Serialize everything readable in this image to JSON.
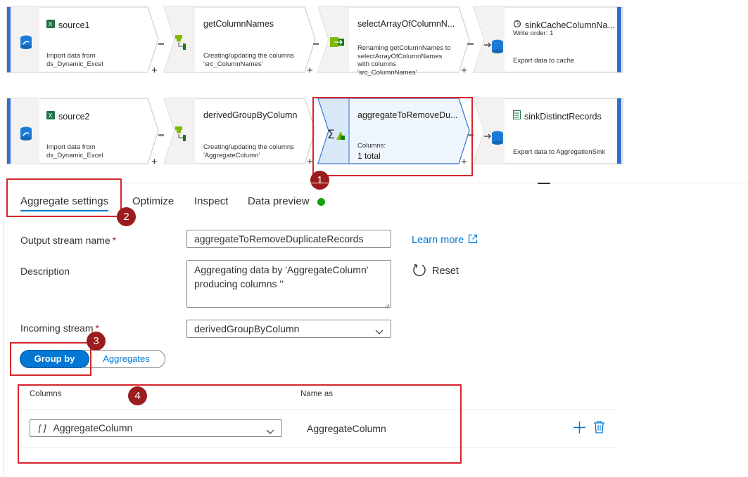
{
  "pipeline": {
    "row1": [
      {
        "title": "source1",
        "desc": "Import data from\nds_Dynamic_Excel"
      },
      {
        "title": "getColumnNames",
        "desc": "Creating/updating the columns\n'src_ColumnNames'"
      },
      {
        "title": "selectArrayOfColumnN...",
        "desc": "Renaming getColumnNames to\nselectArrayOfColumnNames\nwith columns\n'src_ColumnNames'"
      },
      {
        "title": "sinkCacheColumnNa...",
        "subtitle": "Write order: 1",
        "desc": "Export data to cache"
      }
    ],
    "row2": [
      {
        "title": "source2",
        "desc": "Import data from\nds_Dynamic_Excel"
      },
      {
        "title": "derivedGroupByColumn",
        "desc": "Creating/updating the columns\n'AggregateColumn'"
      },
      {
        "title": "aggregateToRemoveDu...",
        "columns_label": "Columns:",
        "columns_value": "1 total"
      },
      {
        "title": "sinkDistinctRecords",
        "desc": "Export data to AggregationSink"
      }
    ],
    "plus": "+"
  },
  "callouts": [
    "1",
    "2",
    "3",
    "4"
  ],
  "tabs": [
    {
      "label": "Aggregate settings",
      "active": true
    },
    {
      "label": "Optimize"
    },
    {
      "label": "Inspect"
    },
    {
      "label": "Data preview"
    }
  ],
  "form": {
    "output_stream_label": "Output stream name",
    "required_mark": "*",
    "output_stream_value": "aggregateToRemoveDuplicateRecords",
    "learn_more": "Learn more",
    "description_label": "Description",
    "description_value": "Aggregating data by 'AggregateColumn'\nproducing columns ''",
    "reset": "Reset",
    "incoming_stream_label": "Incoming stream",
    "incoming_stream_value": "derivedGroupByColumn"
  },
  "toggle": {
    "group_by": "Group by",
    "aggregates": "Aggregates"
  },
  "table": {
    "col_columns": "Columns",
    "col_name_as": "Name as",
    "row_column_icon": "[]",
    "row_column_value": "AggregateColumn",
    "row_name_as": "AggregateColumn"
  },
  "colors": {
    "accent": "#0078d4",
    "callout": "#d6262c",
    "badge": "#9b1c1c",
    "status_green": "#13a10e"
  }
}
